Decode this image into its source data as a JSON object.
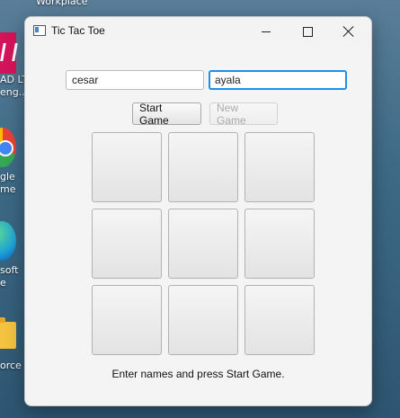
{
  "desktop": {
    "labels": [
      "Workplace",
      "AD LT",
      "eng...",
      "gle",
      "me",
      "soft",
      "e",
      "orce"
    ]
  },
  "window": {
    "title": "Tic Tac Toe"
  },
  "inputs": {
    "player1_value": "cesar",
    "player2_value": "ayala"
  },
  "buttons": {
    "start_label": "Start Game",
    "new_label": "New Game"
  },
  "board": {
    "cells": [
      "",
      "",
      "",
      "",
      "",
      "",
      "",
      "",
      ""
    ]
  },
  "status": {
    "message": "Enter names and press Start Game."
  }
}
